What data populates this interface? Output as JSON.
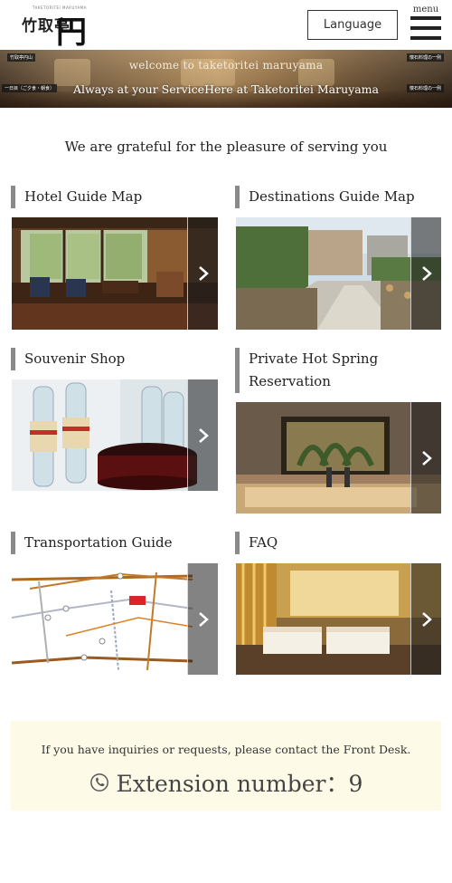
{
  "header": {
    "logo_small": "TAKETORITEI MARUYAMA",
    "logo_kanji": "竹取亭",
    "logo_kana": "円山",
    "language_label": "Language",
    "menu_label": "menu"
  },
  "banner": {
    "sign_left_top": "竹取亭円山",
    "sign_left_bottom": "一日目（ご夕食・朝食）",
    "sign_right_top": "懐石料理の一例",
    "sign_right_bottom": "懐石料理の一例",
    "subtitle": "welcome to taketoritei maruyama",
    "title": "Always at your ServiceHere at Taketoritei Maruyama"
  },
  "intro": "We are grateful for the pleasure of serving you",
  "cards": [
    {
      "title": "Hotel Guide Map",
      "image": "hotel-lobby"
    },
    {
      "title": "Destinations Guide Map",
      "image": "hot-spring-town"
    },
    {
      "title": "Souvenir Shop",
      "image": "cider-bottles"
    },
    {
      "title_line1": "Private Hot Spring",
      "title_line2": "Reservation",
      "image": "private-bath"
    },
    {
      "title": "Transportation Guide",
      "image": "route-map"
    },
    {
      "title": "FAQ",
      "image": "guest-room"
    }
  ],
  "contact": {
    "text": "If you have inquiries or requests, please contact the Front Desk.",
    "extension": "Extension number：9",
    "icon": "phone-icon"
  },
  "colors": {
    "accent_bar": "#8a8a8a",
    "contact_bg": "#fdfbe7",
    "text": "#222222"
  }
}
